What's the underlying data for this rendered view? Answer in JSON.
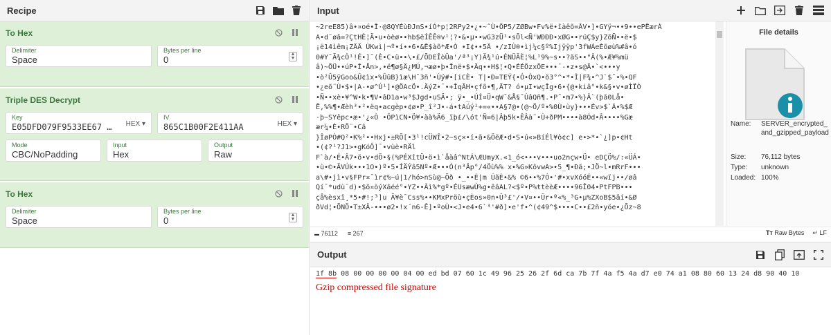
{
  "recipe": {
    "title": "Recipe",
    "ops": [
      {
        "title": "To Hex",
        "fields": [
          {
            "label": "Delimiter",
            "value": "Space"
          },
          {
            "label": "Bytes per line",
            "value": "0"
          }
        ]
      },
      {
        "title": "Triple DES Decrypt",
        "fields_row1": [
          {
            "label": "Key",
            "value": "E05DFD079F9533EE67 …",
            "format": "HEX"
          },
          {
            "label": "IV",
            "value": "865C1B00F2E411AA",
            "format": "HEX"
          }
        ],
        "fields_row2": [
          {
            "label": "Mode",
            "value": "CBC/NoPadding"
          },
          {
            "label": "Input",
            "value": "Hex"
          },
          {
            "label": "Output",
            "value": "Raw"
          }
        ]
      },
      {
        "title": "To Hex",
        "fields": [
          {
            "label": "Delimiter",
            "value": "Space"
          },
          {
            "label": "Bytes per line",
            "value": "0"
          }
        ]
      }
    ]
  },
  "input": {
    "title": "Input",
    "lines": [
      "~2reE85)â•¤oé•Î·@8QYÉùÐJnS•íÓ*p¦2RPy2•¿•~ˆÙ•ÕP5/ZØBw•Fv%ë•îàêõ=ÂV•]•GYÿ¬••9••ePËærÀ",
      "A•d¨øâ=?ÇtHÈ¦Ä•u•òèø••hb$ëÍÊÊ®v¹¦?•&•µ••wG3zÜ¹•sÕl<Ñ'WÐÐÐ•xØG••rúÇ$y}ZõÑ••ë•$",
      "¡ë14ìêm¡ZÄÄ ÙKwì|¬º•í••6•&Ê$àõ*Æ•Ò •I¢••5Ä •/zIÙ®•ìj¼c§º%Ijÿÿp'3fWÁeÈõøù%#â•ó",
      "0#Y¯Ã¾cÒ¹!É•]¯(È•C•ü••\\•£/ÕDEÎòÛa'/ª³¡Y)Ä¾¹ú•ÉNÜÄÈ¦%L¹9%~s••?ãS••\"Â(%•Æ¥%mü",
      "â)~ÕÜ••úP•Î•Ån>,•ë¶ø§Ä¿MÚ,¬æø•þ•Înë•$•Äq••H$¦•Q•ÉÉÖzxÕE•••¯-•z•s@Ã•`<•••y",
      "•ò²Û5ÿGoo&Û¢ìx•%ÛûB}ìæ\\H¯3ñ'•Úý#•[iCÈ• T|•Ð=TEÝ{•Ó•ÒxQ•õ3°^•*•Ì|F¾•^J`$¯•%•QF",
      "•¿eõ¨Ù•$•|A-•ø^Ú¹]•@ÖAcÖ•.ÄýZ•¯•+ÎqÃH•çfõ•¶,ÃT? ó•µI•wçÎg•6•{@•kiâ°•k&§•v•øÌÏÒ",
      "•Ñ••xè•¥^W•k•¶V•âD1a•w³$Jgd•uSÄ•; ÿ•_•ÚÍ¤Ü•qW¯&Å§¯ÚâQñ¶.•P¯•m7•%}Â`(þã0Lå•",
      "Ë,%%¶•Æèh³•²•ëq•acgèp•¢ø•P_î²J•-á•tAúý¹+=«••A§7@•(@~Ö/º•%0Ù•ùy}•••Év>$`Á•%$Æ",
      "·þ~SYêpc•æ•'¿«Ò •ÔPìCN•Ö¥•àà%Ä6_ïþ£/\\ót'Ñ=6|Âþ5k•ÊÂà¨•Ù+ðPM••••à8Ód•Â••••%Gæ",
      "ær¼•È•RÕ¨•Câ",
      "}ÎøPÓ#Q²•K%²••Hxj•±RÕ[•3¹!cÜWÎ•2~sç×•í•ã•&ÖëÆ•d•S•ú«»BíÉl¥ò¢c] e•>*•`¿]p•¢Ht",
      "•(¢?¹?J1>•gKóÔ]¯•vùè•RÄl",
      "F`à/•É•Â7•ö•v•dÕ•§(%PÉXîtÜ•ö•ì`åàâ^NtÁ\\ÆUmyX.«1_ó<•••v•••uo2nçw•Ü• eDÇÖ%/:«ÜÁ•",
      "•ù•©•ÄVÚk•••1O•)º•5•ÍÄÝâ5Nº•Æ•••Ò(n³Âp°/4Öù%% x•%G»KôvwA>•5_¶•Ðã;•JÖ~l•mRrF•••",
      "a\\#•jì•v§FPr¤¯ìr¢%~ú|1/hó>nSù@~Õð •_••È|m ÚãÈ•&% ©6••%7Ó•'#•xvXóóÉ••«wïj••/øâ",
      "Qí¯*udù¨d)•$õ¤òýXâéé°•YZ••Àì%*gº•ÉUsæwÚ%g•êâAL?<$º•P%ŧtèèÆ••••96Î04•PtFPB•••",
      "çå%èsxî¸*5•#!;³]u Ã¥è¯Css%••KMxPröù•çÈos»0n•Û³£'/•V¤••Ür•º«%_³G•µ%ZXoB$5âí•&Ø",
      "ðVd¦•ÕNÖ•T±XÂ-•••ø2•!x´n6-Ê]•ºoÙ•<J•e4•6`³'#ð]•e'f•^(¢49^$••••C••£2ñ•yöe•¿Õz~8"
    ]
  },
  "details": {
    "title": "File details",
    "name_label": "Name:",
    "name_value": "SERVER_encrypted_and_gzipped_payload",
    "size_label": "Size:",
    "size_value": "76,112 bytes",
    "type_label": "Type:",
    "type_value": "unknown",
    "loaded_label": "Loaded:",
    "loaded_value": "100%"
  },
  "status": {
    "length": "76112",
    "lines": "267",
    "raw_bytes": "Raw Bytes",
    "eol": "LF"
  },
  "output": {
    "title": "Output",
    "hex_first": "1f 8b",
    "hex_rest": " 08 00 00 00 00 04 00 ed bd 07 60 1c 49 96 25 26 2f 6d ca 7b 7f 4a f5 4a d7 e0 74 a1 08 80 60 13 24 d8 90 40 10",
    "note": "Gzip compressed file signature"
  },
  "colors": {
    "op_bg": "#dff0d8",
    "op_title": "#3c763d",
    "note": "#d00000",
    "info_blue": "#1a8fa8"
  }
}
